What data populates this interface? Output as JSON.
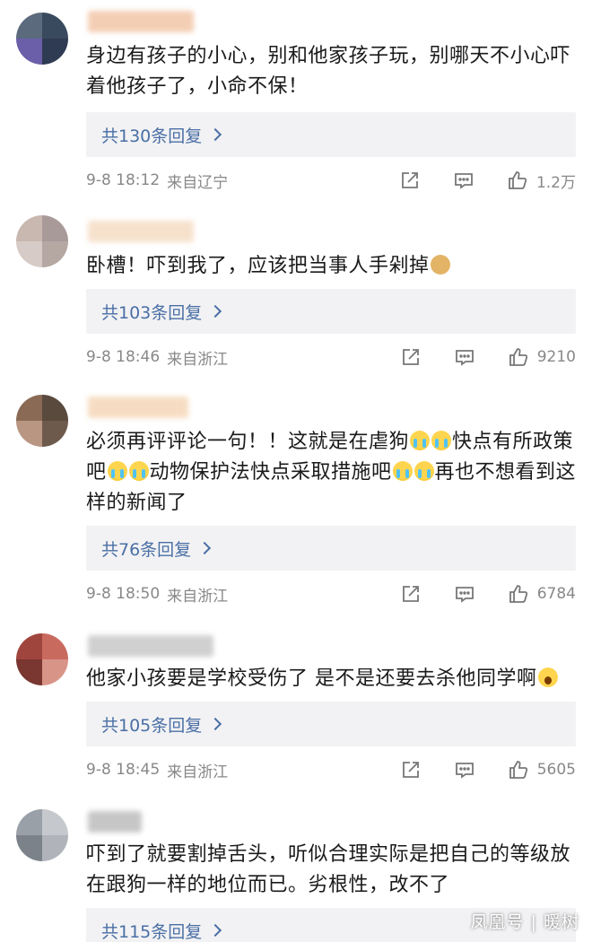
{
  "comments": [
    {
      "text": "身边有孩子的小心，别和他家孩子玩，别哪天不小心吓着他孩子了，小命不保！",
      "replies_label": "共130条回复",
      "time": "9-8 18:12",
      "location": "来自辽宁",
      "likes": "1.2万",
      "avatar_colors": [
        "#5b6a7d",
        "#3a4a5e",
        "#6a5fa8",
        "#2e3b52"
      ],
      "name_color": "#f2c6a8"
    },
    {
      "text": "卧槽！吓到我了，应该把当事人手剁掉",
      "replies_label": "共103条回复",
      "time": "9-8 18:46",
      "location": "来自浙江",
      "likes": "9210",
      "avatar_colors": [
        "#c9b8b0",
        "#a89a98",
        "#d6cbc6",
        "#b5a7a2"
      ],
      "name_color": "#f5dcc4"
    },
    {
      "text": "必须再评评论一句！！这就是在虐狗",
      "text_mid1": "快点有所政策吧",
      "text_mid2": "动物保护法快点采取措施吧",
      "text_end": "再也不想看到这样的新闻了",
      "replies_label": "共76条回复",
      "time": "9-8 18:50",
      "location": "来自浙江",
      "likes": "6784",
      "avatar_colors": [
        "#8a6a55",
        "#5a4a3e",
        "#b89682",
        "#6e5a4c"
      ],
      "name_color": "#f5d7b8"
    },
    {
      "text": "他家小孩要是学校受伤了 是不是还要去杀他同学啊",
      "replies_label": "共105条回复",
      "time": "9-8 18:45",
      "location": "来自浙江",
      "likes": "5605",
      "avatar_colors": [
        "#a0453e",
        "#c96a5e",
        "#7a3630",
        "#d99488"
      ],
      "name_color": "#c8c8c8"
    },
    {
      "text": "吓到了就要割掉舌头，听似合理实际是把自己的等级放在跟狗一样的地位而已。劣根性，改不了",
      "replies_label": "共115条回复",
      "avatar_colors": [
        "#9aa0a8",
        "#c5c8cc",
        "#7c828a",
        "#b0b4ba"
      ],
      "name_color": "#bdbdbd"
    }
  ],
  "watermark": "凤凰号 | 暖树",
  "colors": {
    "link": "#4a6fa5",
    "meta": "#888888",
    "reply_bg": "#f2f2f4"
  },
  "icons": [
    "share-icon",
    "comment-icon",
    "like-icon"
  ]
}
